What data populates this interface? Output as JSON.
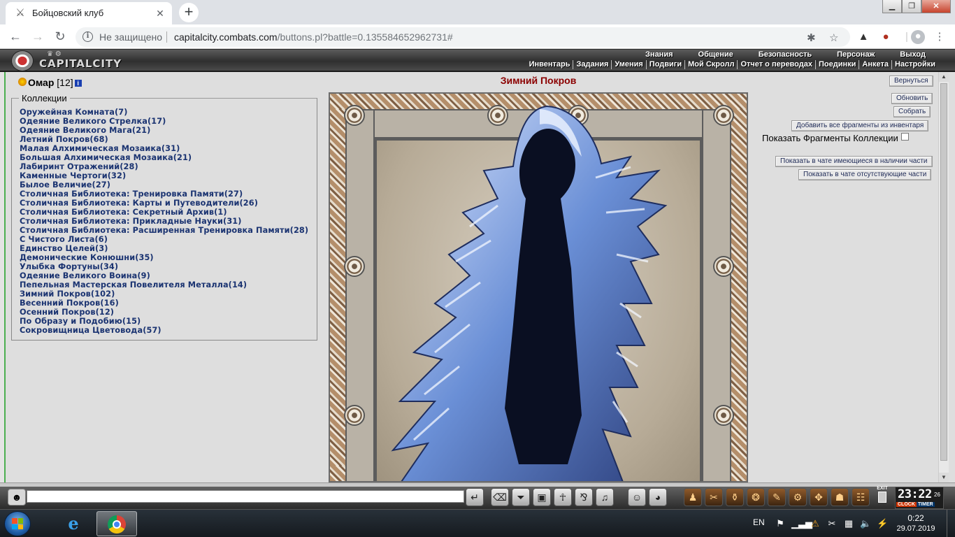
{
  "browser": {
    "tab_title": "Бойцовский клуб",
    "new_tab": "+",
    "security_label": "Не защищено",
    "url_host": "capitalcity.combats.com",
    "url_path": "/buttons.pl?battle=0.135584652962731#"
  },
  "game": {
    "logo_text": "CAPITALCITY",
    "menu_top": [
      "Знания",
      "Общение",
      "Безопасность",
      "Персонаж",
      "Выход"
    ],
    "menu_sub": [
      "Инвентарь",
      "Задания",
      "Умения",
      "Подвиги",
      "Мой Скролл",
      "Отчет о переводах",
      "Поединки",
      "Анкета",
      "Настройки"
    ],
    "player": {
      "name": "Омар",
      "level": "[12]"
    },
    "collections_legend": "Коллекции",
    "collections": [
      "Оружейная Комната(7)",
      "Одеяние Великого Стрелка(17)",
      "Одеяние Великого Мага(21)",
      "Летний Покров(68)",
      "Малая Алхимическая Мозаика(31)",
      "Большая Алхимическая Мозаика(21)",
      "Лабиринт Отражений(28)",
      "Каменные Чертоги(32)",
      "Былое Величие(27)",
      "Столичная Библиотека: Тренировка Памяти(27)",
      "Столичная Библиотека: Карты и Путеводители(26)",
      "Столичная Библиотека: Секретный Архив(1)",
      "Столичная Библиотека: Прикладные Науки(31)",
      "Столичная Библиотека: Расширенная Тренировка Памяти(28)",
      "С Чистого Листа(6)",
      "Единство Целей(3)",
      "Демонические Конюшни(35)",
      "Улыбка Фортуны(34)",
      "Одеяние Великого Воина(9)",
      "Пепельная Мастерская Повелителя Металла(14)",
      "Зимний Покров(102)",
      "Весенний Покров(16)",
      "Осенний Покров(12)",
      "По Образу и Подобию(15)",
      "Сокровищница Цветовода(57)"
    ],
    "collection_title": "Зимний Покров",
    "buttons": {
      "back": "Вернуться",
      "refresh": "Обновить",
      "collect": "Собрать",
      "add_all": "Добавить все фрагменты из инвентаря",
      "show_fragments": "Показать Фрагменты Коллекции",
      "show_have": "Показать в чате имеющиеся в наличии части",
      "show_missing": "Показать в чате отсутствующие части"
    },
    "clock": {
      "time": "23:22",
      "seconds": "26",
      "label_clock": "CLOCK",
      "label_timer": "TIMER",
      "exit_label": "EXIT"
    }
  },
  "taskbar": {
    "lang": "EN",
    "time": "0:22",
    "date": "29.07.2019"
  }
}
